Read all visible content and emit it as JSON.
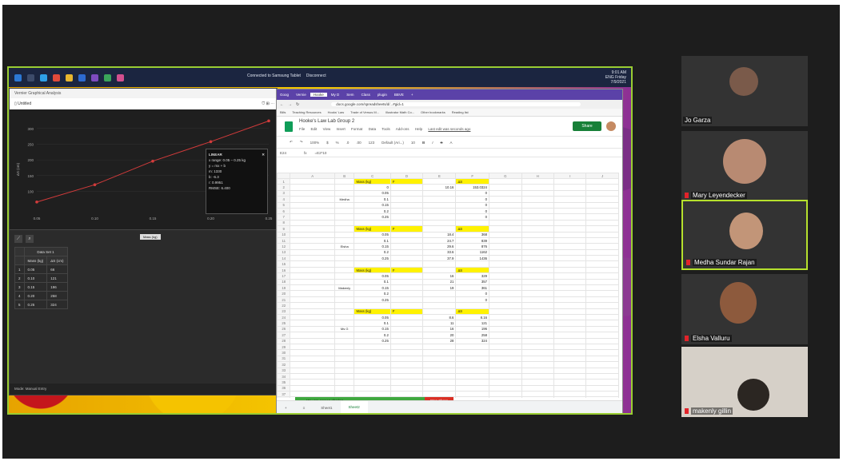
{
  "meeting": {
    "shared_screen": {
      "taskbar": {
        "center_text": "Connected to Samsung Tablet",
        "center_right": "Disconnect",
        "clock_time": "9:01 AM",
        "clock_day": "Friday",
        "clock_date": "7/9/2021",
        "lang": "ENG"
      },
      "vernier": {
        "app_title": "Vernier Graphical Analysis",
        "doc_title": "Untitled",
        "linear_box": {
          "title": "LINEAR",
          "x_range": "x range: 0.05 – 0.25 kg",
          "equation": "y = mx + b",
          "m": "m: 1330",
          "b": "b: -6.3",
          "r": "r: 0.9951",
          "rmse": "RMSE: 6.400"
        },
        "x_axis_button": "Mass (kg)",
        "table": {
          "title": "Data Set 1",
          "headers": [
            "Mass (kg)",
            "ΔS (cm)"
          ],
          "rows": [
            [
              "0.05",
              "66"
            ],
            [
              "0.10",
              "121"
            ],
            [
              "0.15",
              "196"
            ],
            [
              "0.20",
              "258"
            ],
            [
              "0.25",
              "324"
            ]
          ]
        },
        "footer": "Mode: Manual Entry"
      },
      "chart_data": {
        "type": "scatter",
        "title": "",
        "xlabel": "Mass (kg)",
        "ylabel": "ΔS (cm)",
        "x": [
          0.05,
          0.1,
          0.15,
          0.2,
          0.25
        ],
        "y": [
          66,
          121,
          196,
          258,
          324
        ],
        "xlim": [
          0.05,
          0.25
        ],
        "ylim": [
          30,
          330
        ],
        "x_ticks": [
          "0.05",
          "0.10",
          "0.15",
          "0.20",
          "0.25"
        ],
        "y_ticks": [
          "300",
          "250",
          "200",
          "150",
          "100"
        ],
        "fit_line": true,
        "color": "#d23b3b"
      },
      "chrome": {
        "tabs": [
          "Goog",
          "Vernie",
          "Hooke",
          "My D",
          "Sem",
          "Class",
          "plugin",
          "BBVE"
        ],
        "url": "docs.google.com/spreadsheets/d/...#gid=1",
        "bookmarks": [
          "Bills",
          "Teaching Resources",
          "Hooks' Law",
          "Trade of Versus M...",
          "Illustrator Math Co...",
          "Other bookmarks",
          "Reading list"
        ]
      },
      "sheets": {
        "title": "Hooke's Law Lab Group 2",
        "menu": [
          "File",
          "Edit",
          "View",
          "Insert",
          "Format",
          "Data",
          "Tools",
          "Add-ons",
          "Help",
          "Last edit was seconds ago"
        ],
        "share_label": "Share",
        "toolbar": [
          "100%",
          "$",
          "%",
          ".0",
          ".00",
          "123",
          "Default (Ari...)",
          "10",
          "B",
          "I",
          "S",
          "A"
        ],
        "name_box": "E24",
        "formula": "=E2*10",
        "col_headers": [
          "A",
          "B",
          "C",
          "D",
          "E",
          "F",
          "G",
          "H",
          "I",
          "J"
        ],
        "header_mass": "Mass (kg)",
        "header_f": "F",
        "header_dx": "ΔS",
        "groups": [
          {
            "name": "Medha",
            "rows": [
              [
                "0",
                "",
                "10.16",
                "153.0324"
              ],
              [
                "0.05",
                "",
                "",
                "0"
              ],
              [
                "0.1",
                "",
                "",
                "0"
              ],
              [
                "0.15",
                "",
                "",
                "0"
              ],
              [
                "0.2",
                "",
                "",
                "0"
              ],
              [
                "0.25",
                "",
                "",
                "0"
              ]
            ]
          },
          {
            "name": "Elsha",
            "rows": [
              [
                "0.05",
                "",
                "18.4",
                "368"
              ],
              [
                "0.1",
                "",
                "24.7",
                "839"
              ],
              [
                "0.15",
                "",
                "29.6",
                "876"
              ],
              [
                "0.2",
                "",
                "33.6",
                "1162"
              ],
              [
                "0.25",
                "",
                "37.9",
                "1436"
              ]
            ]
          },
          {
            "name": "Makenly",
            "rows": [
              [
                "0.05",
                "",
                "16",
                "329"
              ],
              [
                "0.1",
                "",
                "21",
                "357"
              ],
              [
                "0.15",
                "",
                "19",
                "361"
              ],
              [
                "0.2",
                "",
                "",
                "0"
              ],
              [
                "0.25",
                "",
                "",
                "0"
              ]
            ]
          },
          {
            "name": "Ms G",
            "rows": [
              [
                "0.05",
                "",
                "8.6",
                "8.16"
              ],
              [
                "0.1",
                "",
                "11",
                "121"
              ],
              [
                "0.15",
                "",
                "16",
                "196"
              ],
              [
                "0.2",
                "",
                "20",
                "258"
              ],
              [
                "0.25",
                "",
                "28",
                "324"
              ]
            ]
          }
        ],
        "share_banner": "You are screen sharing",
        "stop_share": "Stop Share",
        "sheet_tabs": [
          "Sheet1",
          "Sheet2"
        ],
        "active_sheet": "Sheet2"
      }
    },
    "participants": [
      {
        "name": "Jo Garza",
        "muted": false,
        "active": false,
        "bg": "#3b2d2a"
      },
      {
        "name": "Mary Leyendecker",
        "muted": true,
        "active": false,
        "bg": "#2f2f2f"
      },
      {
        "name": "Medha Sundar Rajan",
        "muted": true,
        "active": true,
        "bg": "#6e6a6a"
      },
      {
        "name": "Elsha Valluru",
        "muted": true,
        "active": false,
        "bg": "#8a7a6a"
      },
      {
        "name": "makenly gillin",
        "muted": true,
        "active": false,
        "bg": "#cfcac4"
      }
    ]
  }
}
